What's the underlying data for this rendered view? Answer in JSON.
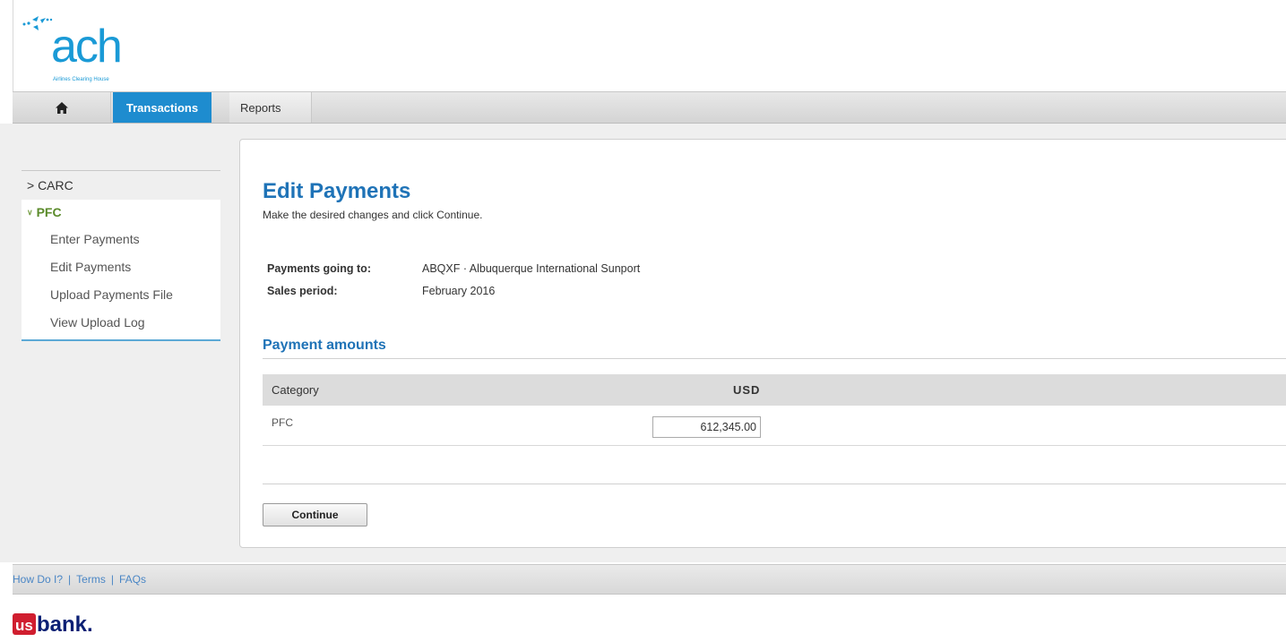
{
  "header": {
    "logo_text": "ach",
    "logo_subtext": "Airlines Clearing House"
  },
  "nav": {
    "tabs": [
      {
        "label": "Transactions",
        "active": true
      },
      {
        "label": "Reports",
        "active": false
      }
    ]
  },
  "sidebar": {
    "carc_label": "> CARC",
    "pfc_label": "PFC",
    "items": [
      {
        "label": "Enter Payments"
      },
      {
        "label": "Edit Payments"
      },
      {
        "label": "Upload Payments File"
      },
      {
        "label": "View Upload Log"
      }
    ]
  },
  "main": {
    "title": "Edit Payments",
    "subtitle": "Make the desired changes and click Continue.",
    "info": [
      {
        "label": "Payments going to:",
        "value": "ABQXF · Albuquerque International Sunport"
      },
      {
        "label": "Sales period:",
        "value": "February 2016"
      }
    ],
    "section_title": "Payment amounts",
    "table": {
      "headers": {
        "category": "Category",
        "usd": "USD"
      },
      "rows": [
        {
          "category": "PFC",
          "usd": "612,345.00"
        }
      ]
    },
    "continue_label": "Continue"
  },
  "footer": {
    "links": [
      {
        "label": "How Do I?"
      },
      {
        "label": "Terms"
      },
      {
        "label": "FAQs"
      }
    ]
  },
  "bank_logo": {
    "text": "usbank."
  },
  "colors": {
    "brand_blue": "#1f73b7",
    "tab_active": "#1e8ccf",
    "pfc_green": "#5a8a2a",
    "usbank_red": "#d01e2f",
    "usbank_navy": "#0c2074"
  }
}
